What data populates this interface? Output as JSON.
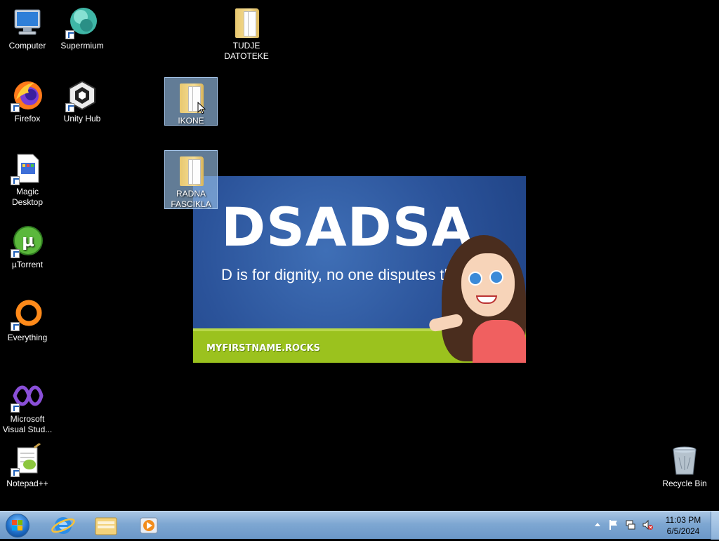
{
  "desktop": {
    "icons": [
      {
        "id": "computer",
        "label": "Computer",
        "icon": "computer-icon",
        "shortcut": false
      },
      {
        "id": "supermium",
        "label": "Supermium",
        "icon": "supermium-icon",
        "shortcut": true
      },
      {
        "id": "tudje",
        "label": "TUDJE DATOTEKE",
        "icon": "folder-icon",
        "shortcut": false
      },
      {
        "id": "firefox",
        "label": "Firefox",
        "icon": "firefox-icon",
        "shortcut": true
      },
      {
        "id": "unityhub",
        "label": "Unity Hub",
        "icon": "unity-hub-icon",
        "shortcut": true
      },
      {
        "id": "ikone",
        "label": "IKONE",
        "icon": "folder-icon",
        "shortcut": false,
        "selected": true
      },
      {
        "id": "magicdesktop",
        "label": "Magic Desktop",
        "icon": "magic-desktop-icon",
        "shortcut": true
      },
      {
        "id": "radna",
        "label": "RADNA FASCIKLA",
        "icon": "folder-icon",
        "shortcut": false,
        "selected": true
      },
      {
        "id": "utorrent",
        "label": "µTorrent",
        "icon": "utorrent-icon",
        "shortcut": true
      },
      {
        "id": "everything",
        "label": "Everything",
        "icon": "everything-icon",
        "shortcut": true
      },
      {
        "id": "vs",
        "label": "Microsoft Visual Stud...",
        "icon": "visual-studio-icon",
        "shortcut": true
      },
      {
        "id": "notepadpp",
        "label": "Notepad++",
        "icon": "notepad-plus-plus-icon",
        "shortcut": true
      },
      {
        "id": "recyclebin",
        "label": "Recycle Bin",
        "icon": "recycle-bin-icon",
        "shortcut": false
      }
    ]
  },
  "wallpaper": {
    "headline": "DSADSA",
    "tagline": "D is for dignity, no one disputes this trait!",
    "site": "MYFIRSTNAME.ROCKS"
  },
  "taskbar": {
    "pinned": [
      {
        "label": "Internet Explorer",
        "icon": "internet-explorer-icon"
      },
      {
        "label": "Windows Explorer",
        "icon": "file-explorer-icon"
      },
      {
        "label": "Windows Media Player",
        "icon": "media-player-icon"
      }
    ],
    "tray": {
      "time": "11:03 PM",
      "date": "6/5/2024"
    }
  },
  "colors": {
    "desktop_bg": "#000000",
    "taskbar": "#7ea7d2",
    "selection": "#96bee6",
    "banner_blue": "#2b539a",
    "banner_green": "#9bc21e"
  }
}
